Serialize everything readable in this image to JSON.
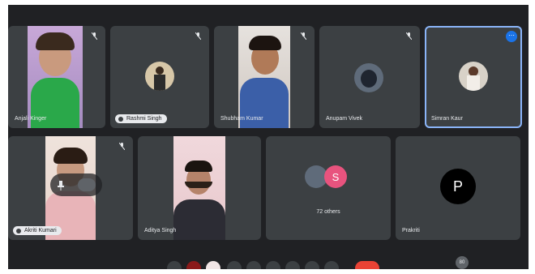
{
  "participants": {
    "row1": [
      {
        "name": "Anjali Kinger",
        "muted": true
      },
      {
        "name": "Rashmi Singh",
        "muted": true
      },
      {
        "name": "Shubham Kumar",
        "muted": true
      },
      {
        "name": "Anupam Vivek",
        "muted": true
      },
      {
        "name": "Simran Kaur",
        "muted": false
      }
    ],
    "row2": [
      {
        "name": "Akriti Kumari",
        "muted": true
      },
      {
        "name": "Aditya Singh",
        "muted": false
      },
      {
        "name": "",
        "muted": false
      },
      {
        "name": "Prakriti",
        "muted": false
      }
    ]
  },
  "others": {
    "label": "72 others",
    "avatar_letter": "S",
    "avatar_color": "#e8537e"
  },
  "prakriti_avatar": {
    "letter": "P",
    "color": "#000000"
  },
  "toolbar": {
    "badge": "80"
  },
  "colors": {
    "tile_bg": "#3c4043",
    "bg": "#202124",
    "accent": "#1a73e8",
    "end_call": "#ea4335"
  }
}
